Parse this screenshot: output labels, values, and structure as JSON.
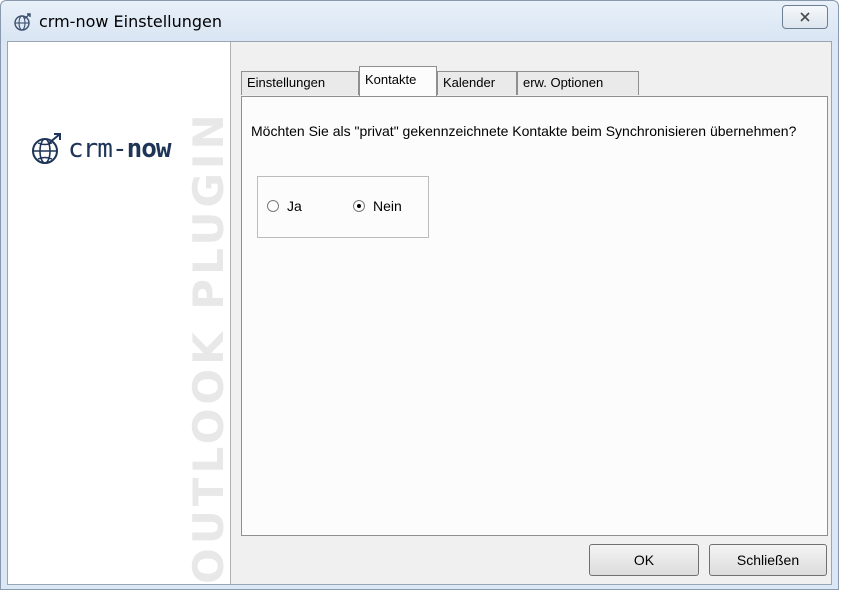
{
  "window": {
    "title": "crm-now Einstellungen",
    "close_glyph": "✕"
  },
  "sidebar": {
    "logo_text_light": "crm-",
    "logo_text_bold": "now",
    "watermark": "OUTLOOK PLUGIN",
    "logo_color": "#1f3557"
  },
  "tabs": [
    {
      "label": "Einstellungen",
      "active": false
    },
    {
      "label": "Kontakte",
      "active": true
    },
    {
      "label": "Kalender",
      "active": false
    },
    {
      "label": "erw. Optionen",
      "active": false
    }
  ],
  "content": {
    "question": "Möchten Sie als \"privat\" gekennzeichnete Kontakte beim Synchronisieren übernehmen?",
    "options": [
      {
        "label": "Ja",
        "checked": false
      },
      {
        "label": "Nein",
        "checked": true
      }
    ]
  },
  "buttons": {
    "ok": "OK",
    "close": "Schließen"
  },
  "icons": {
    "app": "globe-icon",
    "close": "close-icon"
  }
}
